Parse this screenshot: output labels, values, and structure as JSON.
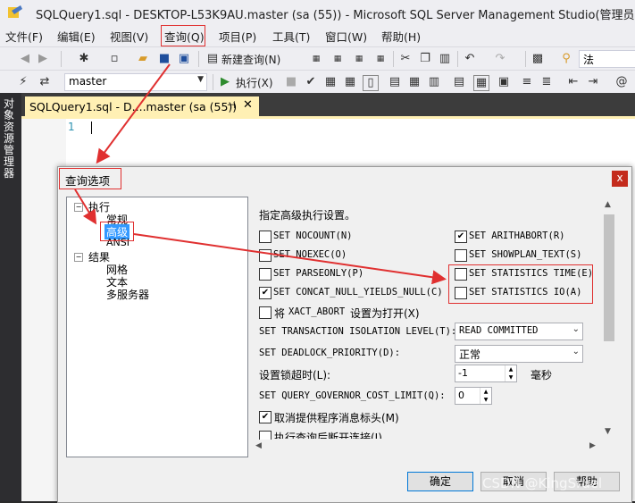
{
  "window": {
    "title": "SQLQuery1.sql - DESKTOP-L53K9AU.master (sa (55)) - Microsoft SQL Server Management Studio(管理员)"
  },
  "menu": [
    "文件(F)",
    "编辑(E)",
    "视图(V)",
    "查询(Q)",
    "项目(P)",
    "工具(T)",
    "窗口(W)",
    "帮助(H)"
  ],
  "toolbar1": {
    "new_query": "新建查询(N)",
    "search_value": "法"
  },
  "toolbar2": {
    "database": "master",
    "execute": "执行(X)"
  },
  "sidebar": {
    "label": "对象资源管理器"
  },
  "doc_tab": {
    "label": "SQLQuery1.sql - D....master (sa (55))",
    "pin": "⊣",
    "close": "✕"
  },
  "editor": {
    "line_number": "1"
  },
  "dialog": {
    "title": "查询选项",
    "close": "x",
    "tree": {
      "execute": "执行",
      "general": "常规",
      "advanced": "高级",
      "ansi": "ANSI",
      "results": "结果",
      "grid": "网格",
      "text": "文本",
      "multiserver": "多服务器"
    },
    "panel": {
      "heading": "指定高级执行设置。",
      "options_left": [
        {
          "label": "SET NOCOUNT(N)",
          "checked": false
        },
        {
          "label": "SET NOEXEC(O)",
          "checked": false
        },
        {
          "label": "SET PARSEONLY(P)",
          "checked": false
        },
        {
          "label": "SET CONCAT_NULL_YIELDS_NULL(C)",
          "checked": true
        }
      ],
      "options_right": [
        {
          "label": "SET ARITHABORT(R)",
          "checked": true
        },
        {
          "label": "SET SHOWPLAN_TEXT(S)",
          "checked": false
        },
        {
          "label": "SET STATISTICS TIME(E)",
          "checked": false
        },
        {
          "label": "SET STATISTICS IO(A)",
          "checked": false
        }
      ],
      "xact_abort": {
        "label_pre": "将",
        "label_code": "XACT_ABORT",
        "label_post": "设置为打开(X)",
        "checked": false
      },
      "isolation": {
        "label": "SET TRANSACTION ISOLATION LEVEL(T):",
        "value": "READ COMMITTED"
      },
      "deadlock": {
        "label": "SET DEADLOCK_PRIORITY(D):",
        "value": "正常"
      },
      "lock_timeout": {
        "label": "设置锁超时(L):",
        "value": "-1",
        "unit": "毫秒"
      },
      "cost_limit": {
        "label": "SET QUERY_GOVERNOR_COST_LIMIT(Q):",
        "value": "0"
      },
      "suppress_header": {
        "label": "取消提供程序消息标头(M)",
        "checked": true
      },
      "disconnect": {
        "label": "执行查询后断开连接(I)",
        "checked": false
      }
    },
    "buttons": {
      "ok": "确定",
      "cancel": "取消",
      "help": "帮助"
    }
  },
  "watermark": "CSDN @KingSruel",
  "colors": {
    "annotation_red": "#e03030",
    "tab_yellow": "#fff0b4",
    "selection_blue": "#3399ff"
  }
}
